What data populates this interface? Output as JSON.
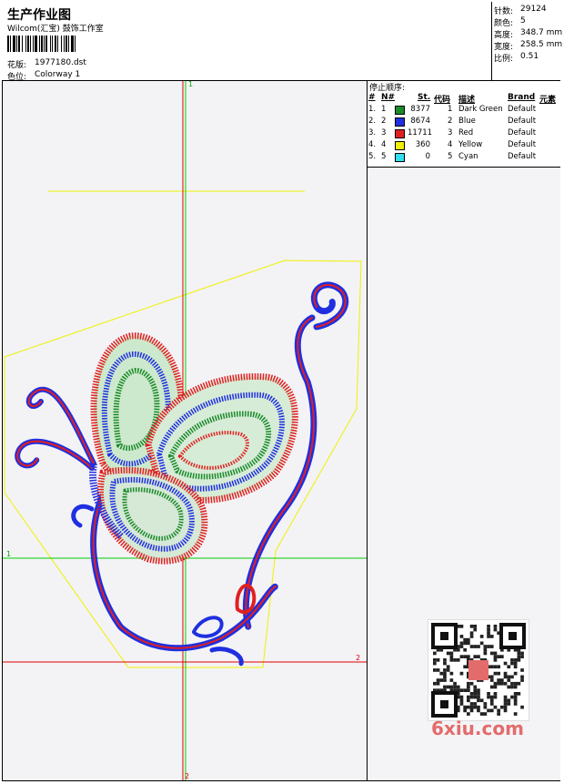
{
  "header": {
    "title": "生产作业图",
    "subtitle": "Wilcom(汇宝) 鼓饰工作室",
    "design_label": "花版:",
    "design_value": "1977180.dst",
    "colorway_label": "色位:",
    "colorway_value": "Colorway 1"
  },
  "stats": [
    {
      "label": "针数:",
      "value": "29124"
    },
    {
      "label": "颜色:",
      "value": "5"
    },
    {
      "label": "高度:",
      "value": "348.7 mm"
    },
    {
      "label": "宽度:",
      "value": "258.5 mm"
    },
    {
      "label": "比例:",
      "value": "0.51"
    }
  ],
  "legend": {
    "title": "停止顺序:",
    "headers": {
      "num": "#",
      "n": "N#",
      "st": "St.",
      "code": "代码",
      "desc": "描述",
      "brand": "Brand",
      "elem": "元素"
    },
    "rows": [
      {
        "num": "1.",
        "n": "1",
        "color": "#1a8a2a",
        "st": "8377",
        "code": "1",
        "desc": "Dark Green",
        "brand": "Default"
      },
      {
        "num": "2.",
        "n": "2",
        "color": "#1f2fe0",
        "st": "8674",
        "code": "2",
        "desc": "Blue",
        "brand": "Default"
      },
      {
        "num": "3.",
        "n": "3",
        "color": "#e02020",
        "st": "11711",
        "code": "3",
        "desc": "Red",
        "brand": "Default"
      },
      {
        "num": "4.",
        "n": "4",
        "color": "#f0f000",
        "st": "360",
        "code": "4",
        "desc": "Yellow",
        "brand": "Default"
      },
      {
        "num": "5.",
        "n": "5",
        "color": "#30e0f0",
        "st": "0",
        "code": "5",
        "desc": "Cyan",
        "brand": "Default"
      }
    ]
  },
  "canvas": {
    "guide_top_label": "1",
    "guide_bottom_label": "2",
    "guide_left_label": "1",
    "guide_right_label": "2"
  },
  "watermark": "6xiu.com",
  "colors": {
    "green": "#1a8a2a",
    "blue": "#1f2fe0",
    "red": "#e02020",
    "yellow": "#f0f000",
    "guide_green": "#00cc00",
    "guide_red": "#e00000"
  }
}
